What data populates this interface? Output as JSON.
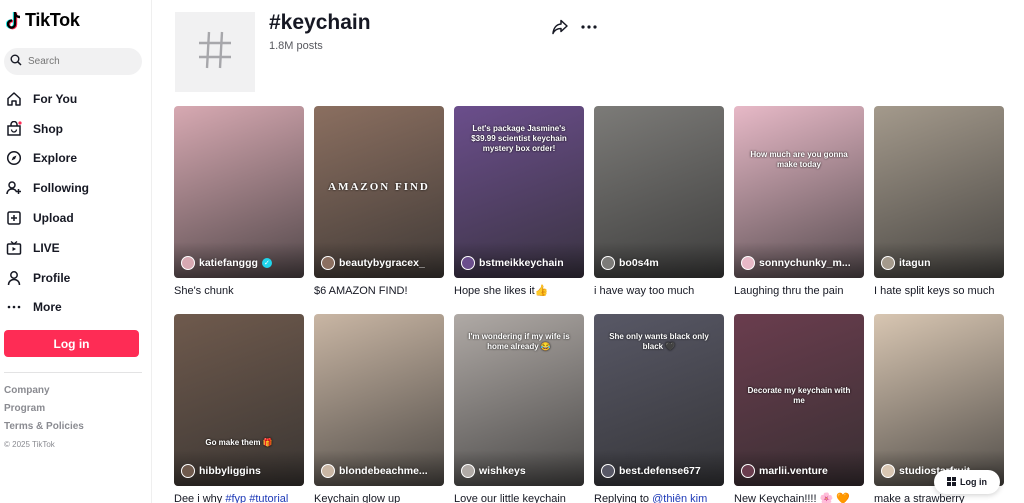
{
  "brand": {
    "name": "TikTok",
    "accent": "#fe2c55"
  },
  "search": {
    "placeholder": "Search"
  },
  "nav": [
    {
      "label": "For You",
      "icon": "home-icon"
    },
    {
      "label": "Shop",
      "icon": "shop-bag-icon"
    },
    {
      "label": "Explore",
      "icon": "compass-icon"
    },
    {
      "label": "Following",
      "icon": "person-add-icon"
    },
    {
      "label": "Upload",
      "icon": "plus-square-icon"
    },
    {
      "label": "LIVE",
      "icon": "tv-icon"
    },
    {
      "label": "Profile",
      "icon": "person-icon"
    },
    {
      "label": "More",
      "icon": "ellipsis-icon"
    }
  ],
  "login_label": "Log in",
  "footer": {
    "company": "Company",
    "program": "Program",
    "terms": "Terms & Policies",
    "copyright": "© 2025 TikTok"
  },
  "hashtag": {
    "title": "#keychain",
    "posts": "1.8M posts"
  },
  "videos": [
    {
      "author": "katiefanggg",
      "verified": true,
      "desc": "She's chunk",
      "overlay": "",
      "bg": "#d7a9b2"
    },
    {
      "author": "beautybygracex_",
      "verified": false,
      "desc": "$6 AMAZON FIND!",
      "overlay": "AMAZON FIND",
      "bg": "#8b6f60"
    },
    {
      "author": "bstmeikkeychain",
      "verified": false,
      "desc": "Hope she likes it👍",
      "overlay": "Let's package Jasmine's $39.99 scientist keychain mystery box order!",
      "bg": "#6b4e8c"
    },
    {
      "author": "bo0s4m",
      "verified": false,
      "desc": "i have way too much",
      "overlay": "",
      "bg": "#7c7b78"
    },
    {
      "author": "sonnychunky_m...",
      "verified": false,
      "desc": "Laughing thru the pain",
      "overlay": "How much are you gonna make today",
      "bg": "#e7b9c7"
    },
    {
      "author": "itagun",
      "verified": false,
      "desc": "I hate split keys so much",
      "overlay": "",
      "bg": "#a49a8c"
    },
    {
      "author": "hibbyliggins",
      "verified": false,
      "desc": "Dee i why #fyp #tutorial",
      "desc_plain": "Dee i why ",
      "desc_tags": "#fyp #tutorial",
      "overlay": "Go make them 🎁",
      "bg": "#6f5a4d"
    },
    {
      "author": "blondebeachme...",
      "verified": false,
      "desc": "Keychain glow up",
      "overlay": "",
      "bg": "#c9b6a4"
    },
    {
      "author": "wishkeys",
      "verified": false,
      "desc": "Love our little keychain",
      "overlay": "I'm wondering if my wife is home already 😂",
      "bg": "#b0aaa6"
    },
    {
      "author": "best.defense677",
      "verified": false,
      "desc": "Replying to @thiên kim",
      "desc_plain": "Replying to ",
      "desc_tags": "@thiên kim",
      "overlay": "She only wants black only black 🖤",
      "bg": "#585866"
    },
    {
      "author": "marlii.venture",
      "verified": false,
      "desc": "New Keychain!!!! 🌸 🧡",
      "overlay": "Decorate my keychain with me",
      "bg": "#6a3d4e"
    },
    {
      "author": "studiostarfruit",
      "verified": false,
      "desc": "make a strawberry",
      "overlay": "",
      "bg": "#d8c6b2"
    }
  ],
  "float_login_label": "Log in"
}
